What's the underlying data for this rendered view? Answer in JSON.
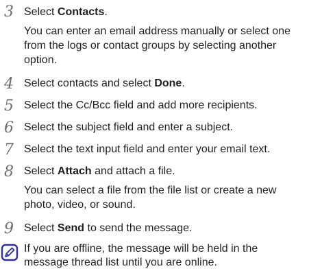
{
  "steps": [
    {
      "number": "3",
      "lines": [
        {
          "pre": "Select ",
          "bold": "Contacts",
          "post": "."
        },
        {
          "text": "You can enter an email address manually or select one"
        },
        {
          "text": "from the logs or contact groups by selecting another"
        },
        {
          "text": "option."
        }
      ]
    },
    {
      "number": "4",
      "lines": [
        {
          "pre": "Select contacts and select ",
          "bold": "Done",
          "post": "."
        }
      ]
    },
    {
      "number": "5",
      "lines": [
        {
          "text": "Select the Cc/Bcc field and add more recipients."
        }
      ]
    },
    {
      "number": "6",
      "lines": [
        {
          "text": "Select the subject field and enter a subject."
        }
      ]
    },
    {
      "number": "7",
      "lines": [
        {
          "text": "Select the text input field and enter your email text."
        }
      ]
    },
    {
      "number": "8",
      "lines": [
        {
          "pre": "Select ",
          "bold": "Attach",
          "post": " and attach a file."
        },
        {
          "text": "You can select a file from the file list or create a new"
        },
        {
          "text": "photo, video, or sound."
        }
      ]
    },
    {
      "number": "9",
      "lines": [
        {
          "pre": "Select ",
          "bold": "Send",
          "post": " to send the message."
        }
      ]
    }
  ],
  "note": {
    "icon": "note-pencil-icon",
    "lines": [
      "If you are offline, the message will be held in the",
      "message thread list until you are online."
    ]
  },
  "colors": {
    "text": "#231f20",
    "step_number": "#6d6e71"
  }
}
